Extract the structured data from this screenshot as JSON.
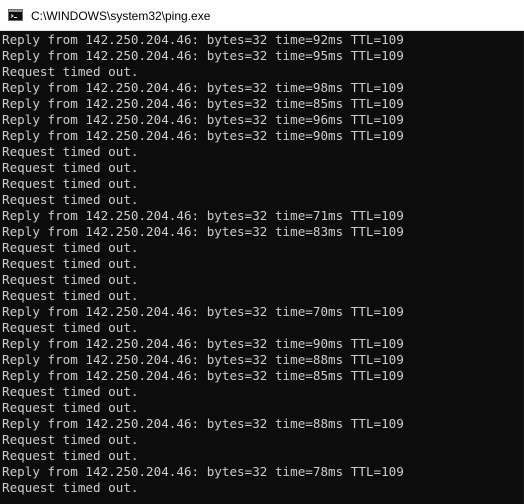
{
  "window": {
    "title": "C:\\WINDOWS\\system32\\ping.exe",
    "icon": "console-app-icon"
  },
  "console": {
    "lines": [
      "Reply from 142.250.204.46: bytes=32 time=92ms TTL=109",
      "Reply from 142.250.204.46: bytes=32 time=95ms TTL=109",
      "Request timed out.",
      "Reply from 142.250.204.46: bytes=32 time=98ms TTL=109",
      "Reply from 142.250.204.46: bytes=32 time=85ms TTL=109",
      "Reply from 142.250.204.46: bytes=32 time=96ms TTL=109",
      "Reply from 142.250.204.46: bytes=32 time=90ms TTL=109",
      "Request timed out.",
      "Request timed out.",
      "Request timed out.",
      "Request timed out.",
      "Reply from 142.250.204.46: bytes=32 time=71ms TTL=109",
      "Reply from 142.250.204.46: bytes=32 time=83ms TTL=109",
      "Request timed out.",
      "Request timed out.",
      "Request timed out.",
      "Request timed out.",
      "Reply from 142.250.204.46: bytes=32 time=70ms TTL=109",
      "Request timed out.",
      "Reply from 142.250.204.46: bytes=32 time=90ms TTL=109",
      "Reply from 142.250.204.46: bytes=32 time=88ms TTL=109",
      "Reply from 142.250.204.46: bytes=32 time=85ms TTL=109",
      "Request timed out.",
      "Request timed out.",
      "Reply from 142.250.204.46: bytes=32 time=88ms TTL=109",
      "Request timed out.",
      "Request timed out.",
      "Reply from 142.250.204.46: bytes=32 time=78ms TTL=109",
      "Request timed out."
    ]
  },
  "colors": {
    "console_background": "#0c0c0c",
    "console_text": "#cccccc",
    "titlebar_background": "#ffffff"
  }
}
